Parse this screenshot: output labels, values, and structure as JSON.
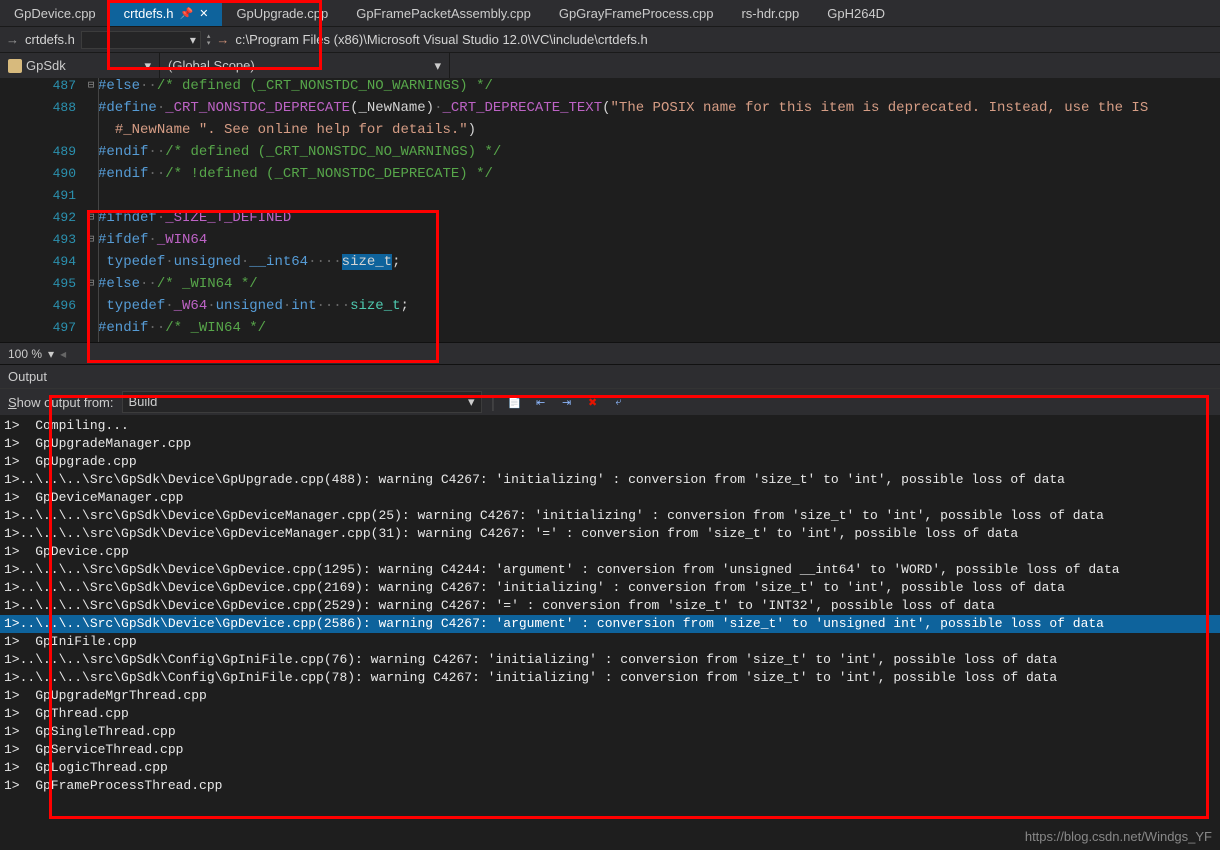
{
  "tabs": [
    {
      "label": "GpDevice.cpp"
    },
    {
      "label": "crtdefs.h",
      "active": true,
      "pinned": true,
      "closable": true
    },
    {
      "label": "GpUpgrade.cpp"
    },
    {
      "label": "GpFramePacketAssembly.cpp"
    },
    {
      "label": "GpGrayFrameProcess.cpp"
    },
    {
      "label": "rs-hdr.cpp"
    },
    {
      "label": "GpH264D"
    }
  ],
  "nav": {
    "arrow": "→",
    "file": "crtdefs.h",
    "path": "c:\\Program Files (x86)\\Microsoft Visual Studio 12.0\\VC\\include\\crtdefs.h"
  },
  "scope": {
    "project": "GpSdk",
    "scopeLabel": "(Global Scope)"
  },
  "code": {
    "lines": [
      {
        "n": "487",
        "fold": "⊟",
        "html": "<span class='kw'>#else</span><span class='dot'>··</span><span class='com'>/* defined (_CRT_NONSTDC_NO_WARNINGS) */</span>"
      },
      {
        "n": "488",
        "fold": "",
        "html": "<span class='kw'>#define</span><span class='dot'>·</span><span class='mac'>_CRT_NONSTDC_DEPRECATE</span>(_NewName)<span class='dot'>·</span><span class='mac'>_CRT_DEPRECATE_TEXT</span>(<span class='str'>\"The POSIX name for this item is deprecated. Instead, use the IS</span>"
      },
      {
        "n": "",
        "fold": "",
        "html": "  <span class='str'>#_NewName \". See online help for details.\"</span>)"
      },
      {
        "n": "489",
        "fold": "",
        "html": "<span class='kw'>#endif</span><span class='dot'>··</span><span class='com'>/* defined (_CRT_NONSTDC_NO_WARNINGS) */</span>"
      },
      {
        "n": "490",
        "fold": "",
        "html": "<span class='kw'>#endif</span><span class='dot'>··</span><span class='com'>/* !defined (_CRT_NONSTDC_DEPRECATE) */</span>"
      },
      {
        "n": "491",
        "fold": "",
        "html": ""
      },
      {
        "n": "492",
        "fold": "⊟",
        "html": "<span class='kw'>#ifndef</span><span class='dot'>·</span><span class='mac'>_SIZE_T_DEFINED</span>"
      },
      {
        "n": "493",
        "fold": "⊟",
        "html": "<span class='kw'>#ifdef</span><span class='dot'>·</span><span class='mac'>_WIN64</span>"
      },
      {
        "n": "494",
        "fold": "",
        "html": " <span class='kw'>typedef</span><span class='dot'>·</span><span class='kw'>unsigned</span><span class='dot'>·</span><span class='lit'>__int64</span><span class='dot'>····</span><span class='hl'>size_t</span>;"
      },
      {
        "n": "495",
        "fold": "⊟",
        "html": "<span class='kw'>#else</span><span class='dot'>··</span><span class='com'>/* _WIN64 */</span>"
      },
      {
        "n": "496",
        "fold": "",
        "html": " <span class='kw'>typedef</span><span class='dot'>·</span><span class='mac'>_W64</span><span class='dot'>·</span><span class='kw'>unsigned</span><span class='dot'>·</span><span class='kw'>int</span><span class='dot'>····</span><span class='typ'>size_t</span>;"
      },
      {
        "n": "497",
        "fold": "",
        "html": "<span class='kw'>#endif</span><span class='dot'>··</span><span class='com'>/* _WIN64 */</span>"
      }
    ]
  },
  "zoom": "100 %",
  "output": {
    "title": "Output",
    "showLabel": "Show output from:",
    "source": "Build",
    "lines": [
      {
        "t": "1>  Compiling..."
      },
      {
        "t": "1>  GpUpgradeManager.cpp"
      },
      {
        "t": "1>  GpUpgrade.cpp"
      },
      {
        "t": "1>..\\..\\..\\Src\\GpSdk\\Device\\GpUpgrade.cpp(488): warning C4267: 'initializing' : conversion from 'size_t' to 'int', possible loss of data"
      },
      {
        "t": "1>  GpDeviceManager.cpp"
      },
      {
        "t": "1>..\\..\\..\\src\\GpSdk\\Device\\GpDeviceManager.cpp(25): warning C4267: 'initializing' : conversion from 'size_t' to 'int', possible loss of data"
      },
      {
        "t": "1>..\\..\\..\\src\\GpSdk\\Device\\GpDeviceManager.cpp(31): warning C4267: '=' : conversion from 'size_t' to 'int', possible loss of data"
      },
      {
        "t": "1>  GpDevice.cpp"
      },
      {
        "t": "1>..\\..\\..\\Src\\GpSdk\\Device\\GpDevice.cpp(1295): warning C4244: 'argument' : conversion from 'unsigned __int64' to 'WORD', possible loss of data"
      },
      {
        "t": "1>..\\..\\..\\Src\\GpSdk\\Device\\GpDevice.cpp(2169): warning C4267: 'initializing' : conversion from 'size_t' to 'int', possible loss of data"
      },
      {
        "t": "1>..\\..\\..\\Src\\GpSdk\\Device\\GpDevice.cpp(2529): warning C4267: '=' : conversion from 'size_t' to 'INT32', possible loss of data"
      },
      {
        "t": "1>..\\..\\..\\Src\\GpSdk\\Device\\GpDevice.cpp(2586): warning C4267: 'argument' : conversion from 'size_t' to 'unsigned int', possible loss of data",
        "sel": true
      },
      {
        "t": "1>  GpIniFile.cpp"
      },
      {
        "t": "1>..\\..\\..\\src\\GpSdk\\Config\\GpIniFile.cpp(76): warning C4267: 'initializing' : conversion from 'size_t' to 'int', possible loss of data"
      },
      {
        "t": "1>..\\..\\..\\src\\GpSdk\\Config\\GpIniFile.cpp(78): warning C4267: 'initializing' : conversion from 'size_t' to 'int', possible loss of data"
      },
      {
        "t": "1>  GpUpgradeMgrThread.cpp"
      },
      {
        "t": "1>  GpThread.cpp"
      },
      {
        "t": "1>  GpSingleThread.cpp"
      },
      {
        "t": "1>  GpServiceThread.cpp"
      },
      {
        "t": "1>  GpLogicThread.cpp"
      },
      {
        "t": "1>  GpFrameProcessThread.cpp"
      }
    ]
  },
  "watermark": "https://blog.csdn.net/Windgs_YF"
}
